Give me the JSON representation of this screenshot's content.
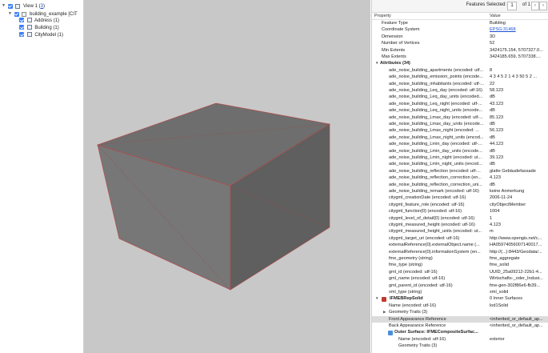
{
  "tree": [
    {
      "label": "View 1 (",
      "count": "3",
      "tail": ")"
    },
    {
      "label": "building_example [CIT"
    },
    {
      "label": "Address (1)"
    },
    {
      "label": "Building (1)"
    },
    {
      "label": "CityModel (1)"
    }
  ],
  "toolbar": {
    "features_selected_label": "Features Selected:",
    "page_value": "1",
    "of_label": "of 1",
    "prev": "‹",
    "next": "›"
  },
  "table": {
    "header_property": "Property",
    "header_value": "Value",
    "rows": [
      {
        "k": "Feature Type",
        "v": "Building"
      },
      {
        "k": "Coordinate System",
        "v": "EPSG:31468"
      },
      {
        "k": "Dimension",
        "v": "3D"
      },
      {
        "k": "Number of Vertices",
        "v": "52"
      },
      {
        "k": "Min Extents",
        "v": "3424175.154, 5707327.0..."
      },
      {
        "k": "Max Extents",
        "v": "3424185.659, 5707338...."
      },
      {
        "k": "Attributes (34)",
        "v": ""
      },
      {
        "k": "ade_noise_building_apartments (encoded: utf...",
        "v": "8"
      },
      {
        "k": "ade_noise_building_emission_points (encode...",
        "v": "4 3 4 5 2 1 4 3 50 5 2 ..."
      },
      {
        "k": "ade_noise_building_inhabitants (encoded: utf-...",
        "v": "22"
      },
      {
        "k": "ade_noise_building_Leq_day (encoded: utf-16)",
        "v": "58.123"
      },
      {
        "k": "ade_noise_building_Leq_day_units (encoded...",
        "v": "dB"
      },
      {
        "k": "ade_noise_building_Leq_night (encoded: utf-...",
        "v": "43.123"
      },
      {
        "k": "ade_noise_building_Leq_night_units (encode...",
        "v": "dB"
      },
      {
        "k": "ade_noise_building_Lmax_day (encoded: utf-...",
        "v": "85.123"
      },
      {
        "k": "ade_noise_building_Lmax_day_units (encode...",
        "v": "dB"
      },
      {
        "k": "ade_noise_building_Lmax_night (encoded: ...",
        "v": "56.123"
      },
      {
        "k": "ade_noise_building_Lmax_night_units (encod...",
        "v": "dB"
      },
      {
        "k": "ade_noise_building_Lmin_day (encoded: utf-...",
        "v": "44.123"
      },
      {
        "k": "ade_noise_building_Lmin_day_units (encode...",
        "v": "dB"
      },
      {
        "k": "ade_noise_building_Lmin_night (encoded: ut...",
        "v": "39.123"
      },
      {
        "k": "ade_noise_building_Lmin_night_units (encod...",
        "v": "dB"
      },
      {
        "k": "ade_noise_building_reflection (encoded: utf-...",
        "v": "glatte Gebäudefassade"
      },
      {
        "k": "ade_noise_building_reflection_correction (en...",
        "v": "4.123"
      },
      {
        "k": "ade_noise_building_reflection_correction_uni...",
        "v": "dB"
      },
      {
        "k": "ade_noise_building_remark (encoded: utf-16)",
        "v": "keine Anmerkung"
      },
      {
        "k": "citygml_creationDate (encoded: utf-16)",
        "v": "2006-11-24"
      },
      {
        "k": "citygml_feature_role (encoded: utf-16)",
        "v": "cityObjectMember"
      },
      {
        "k": "citygml_function{0} (encoded: utf-16)",
        "v": "1004"
      },
      {
        "k": "citygml_level_of_detail{0} (encoded: utf-16)",
        "v": "1"
      },
      {
        "k": "citygml_measured_height (encoded: utf-16)",
        "v": "4.123"
      },
      {
        "k": "citygml_measured_height_units (encoded: ut...",
        "v": "m"
      },
      {
        "k": "citygml_target_uri (encoded: utf-16)",
        "v": "http://www.opengis.net/c..."
      },
      {
        "k": "externalReference{0}.externalObject.name (...",
        "v": "HA0597405600714001​7..."
      },
      {
        "k": "externalReference{0}.informationSystem (en...",
        "v": "http://{...}:8443/Geodata/..."
      },
      {
        "k": "fme_geometry (string)",
        "v": "fme_aggregate"
      },
      {
        "k": "fme_type (string)",
        "v": "fme_solid"
      },
      {
        "k": "gml_id (encoded: utf-16)",
        "v": "UUID_25a09212-22b1-4..."
      },
      {
        "k": "gml_name (encoded: utf-16)",
        "v": "Wirtschafts-_oder_Indust..."
      },
      {
        "k": "gml_parent_id (encoded: utf-16)",
        "v": "fme-gen-302f86e6-fb39..."
      },
      {
        "k": "xml_type (string)",
        "v": "xml_solid"
      },
      {
        "k": "IFMEBRepSolid",
        "v": "0 Inner Surfaces"
      },
      {
        "k": "Name (encoded: utf-16)",
        "v": "lod1Solid"
      },
      {
        "k": "Geometry Traits (3)",
        "v": ""
      },
      {
        "k": "Front Appearance Reference",
        "v": "<inherited_or_default_ap..."
      },
      {
        "k": "Back Appearance Reference",
        "v": "<inherited_or_default_ap..."
      },
      {
        "k": "Outer Surface: IFMECompositeSurfac...",
        "v": ""
      },
      {
        "k": "Name (encoded: utf-16)",
        "v": "exterior"
      },
      {
        "k": "Geometry Traits (3)",
        "v": ""
      }
    ]
  },
  "colors": {
    "accent": "#3a80f7",
    "viewport_bg": "#c8c8c8",
    "box_top": "#6e6e6e",
    "box_front": "#757575",
    "box_side": "#5e5e5e",
    "edge": "#b34a4a"
  }
}
